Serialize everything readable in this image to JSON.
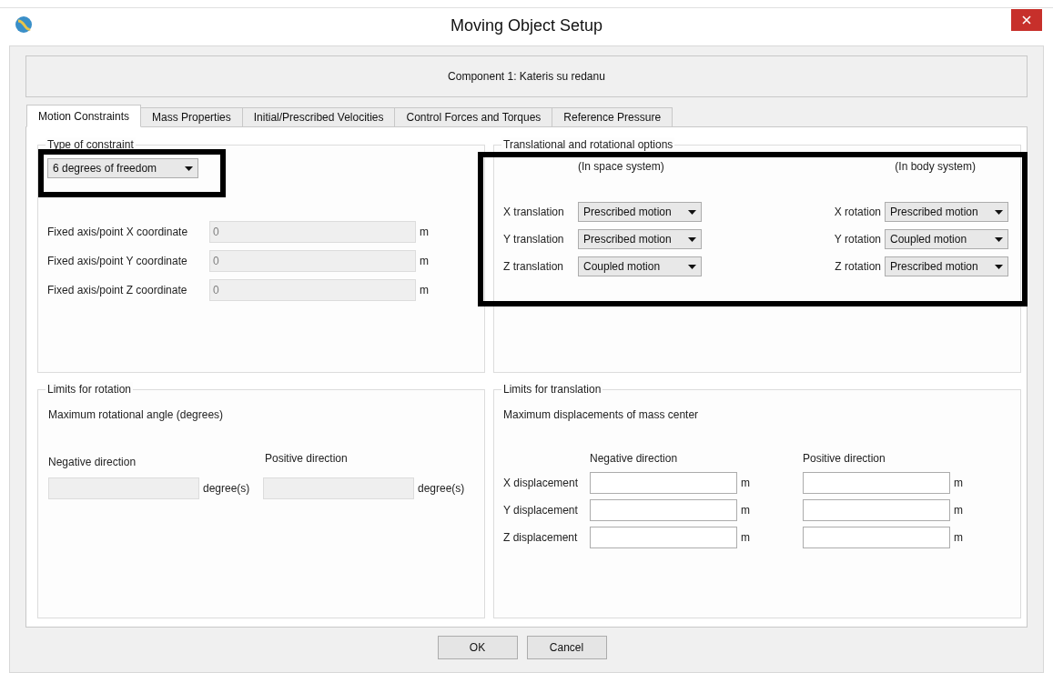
{
  "window": {
    "title": "Moving Object Setup"
  },
  "component_label": "Component 1: Kateris su redanu",
  "tabs": [
    {
      "label": "Motion Constraints",
      "selected": true
    },
    {
      "label": "Mass Properties",
      "selected": false
    },
    {
      "label": "Initial/Prescribed Velocities",
      "selected": false
    },
    {
      "label": "Control Forces and Torques",
      "selected": false
    },
    {
      "label": "Reference Pressure",
      "selected": false
    }
  ],
  "constraint": {
    "title": "Type of constraint",
    "dropdown": "6 degrees of freedom",
    "fields": [
      {
        "label": "Fixed axis/point X coordinate",
        "value": "0",
        "unit": "m",
        "disabled": true
      },
      {
        "label": "Fixed axis/point Y coordinate",
        "value": "0",
        "unit": "m",
        "disabled": true
      },
      {
        "label": "Fixed axis/point Z coordinate",
        "value": "0",
        "unit": "m",
        "disabled": true
      }
    ]
  },
  "options": {
    "title": "Translational and rotational options",
    "space_header": "(In space system)",
    "body_header": "(In body system)",
    "translations": [
      {
        "label": "X translation",
        "value": "Prescribed motion"
      },
      {
        "label": "Y translation",
        "value": "Prescribed motion"
      },
      {
        "label": "Z translation",
        "value": "Coupled motion"
      }
    ],
    "rotations": [
      {
        "label": "X rotation",
        "value": "Prescribed motion"
      },
      {
        "label": "Y rotation",
        "value": "Coupled motion"
      },
      {
        "label": "Z rotation",
        "value": "Prescribed motion"
      }
    ]
  },
  "rotation_limits": {
    "title": "Limits for rotation",
    "subtitle": "Maximum rotational angle (degrees)",
    "negative_label": "Negative direction",
    "positive_label": "Positive direction",
    "fields": [
      {
        "unit": "degree(s)",
        "disabled": true
      },
      {
        "unit": "degree(s)",
        "disabled": true
      }
    ]
  },
  "translation_limits": {
    "title": "Limits for translation",
    "subtitle": "Maximum displacements of mass center",
    "negative_label": "Negative direction",
    "positive_label": "Positive direction",
    "rows": [
      {
        "label": "X displacement",
        "unit_negative": "m",
        "unit_positive": "m",
        "disabled": false
      },
      {
        "label": "Y displacement",
        "unit_negative": "m",
        "unit_positive": "m",
        "disabled": false
      },
      {
        "label": "Z displacement",
        "unit_negative": "m",
        "unit_positive": "m",
        "disabled": false
      }
    ]
  },
  "buttons": [
    "OK",
    "Cancel"
  ]
}
